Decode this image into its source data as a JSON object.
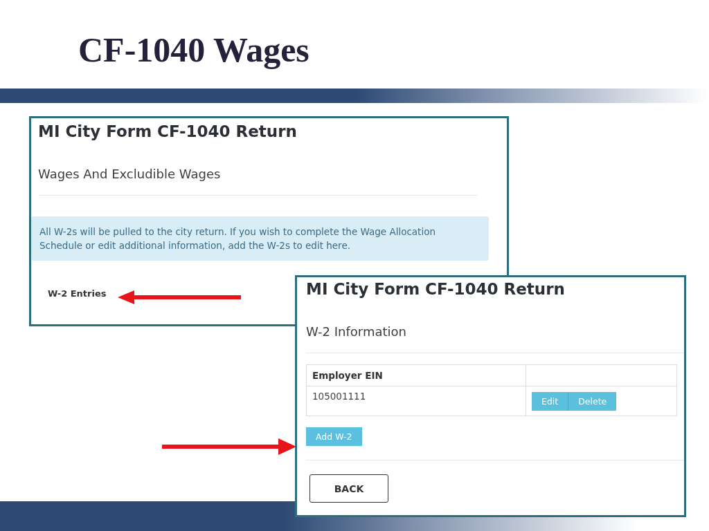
{
  "slide": {
    "title": "CF-1040 Wages"
  },
  "screen_1": {
    "title": "MI City Form CF-1040 Return",
    "section": "Wages And Excludible Wages",
    "info": "All W-2s will be pulled to the city return. If you wish to complete the Wage Allocation Schedule or edit additional information, add the W-2s to edit here.",
    "link": "W-2 Entries"
  },
  "screen_2": {
    "title": "MI City Form CF-1040 Return",
    "section": "W-2 Information",
    "table": {
      "columns": [
        "Employer EIN"
      ],
      "rows": [
        {
          "ein": "105001111",
          "actions": [
            "Edit",
            "Delete"
          ]
        }
      ]
    },
    "add_button": "Add W-2",
    "back_button": "BACK"
  }
}
